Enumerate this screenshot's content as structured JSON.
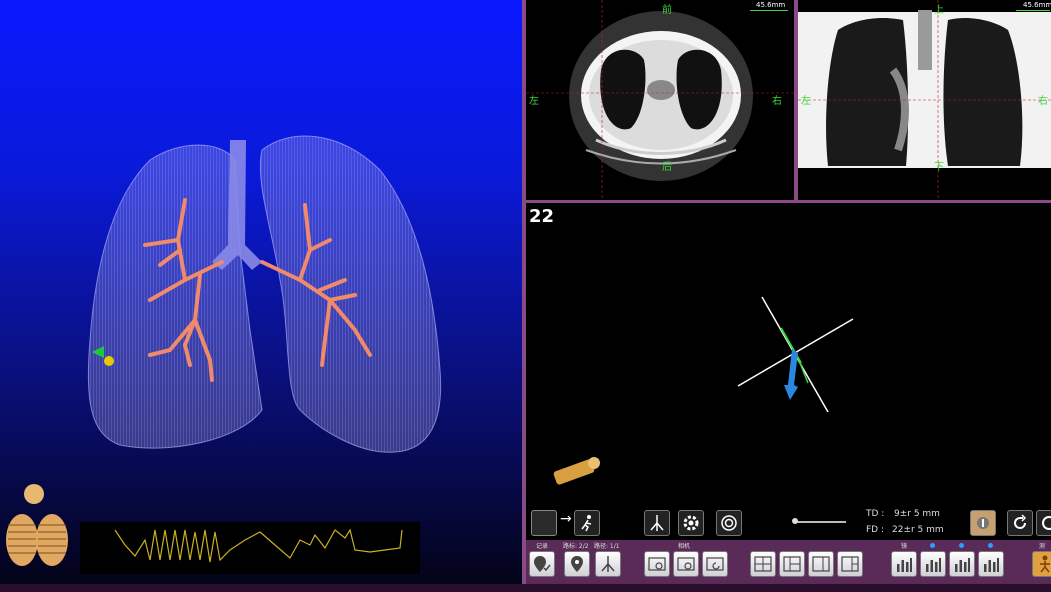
{
  "axial_view": {
    "top": "前",
    "bottom": "后",
    "left": "左",
    "right": "右",
    "scale": "45.6mm"
  },
  "coronal_view": {
    "top": "上",
    "bottom": "下",
    "left": "左",
    "right": "右",
    "scale": "45.6mm"
  },
  "endo_view": {
    "number": "22",
    "td_label": "TD :",
    "td_value": "9±r 5 mm",
    "fd_label": "FD :",
    "fd_value": "22±r 5 mm",
    "arrow": "→"
  },
  "toolbar": {
    "record_label": "记录",
    "path_point_label": "路标: 2/2",
    "path_label": "路径: 1/1",
    "camera_label": "相机",
    "lens_label": "镜",
    "more_label": "测"
  },
  "colors": {
    "panel_border": "#8a4a86",
    "toolbar_bg": "#5a2a58",
    "airway": "#f08a6a",
    "trachea": "#8a8ae8",
    "orient_text": "#3ad83a"
  }
}
